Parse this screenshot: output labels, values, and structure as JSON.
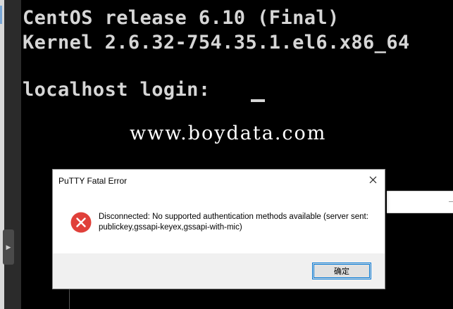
{
  "terminal": {
    "line1": "CentOS release 6.10 (Final)",
    "line2": "Kernel 2.6.32-754.35.1.el6.x86_64",
    "line3": "localhost login: ",
    "watermark": "www.boydata.com"
  },
  "dialog": {
    "title": "PuTTY Fatal Error",
    "close_icon": "close-icon",
    "message": "Disconnected: No supported authentication methods available (server sent: publickey,gssapi-keyex,gssapi-with-mic)",
    "error_icon": "error-icon",
    "ok_label": "确定"
  },
  "colors": {
    "terminal_bg": "#000000",
    "terminal_fg": "#d6d6d6",
    "error_red": "#e0403a",
    "button_focus": "#0078d7"
  }
}
